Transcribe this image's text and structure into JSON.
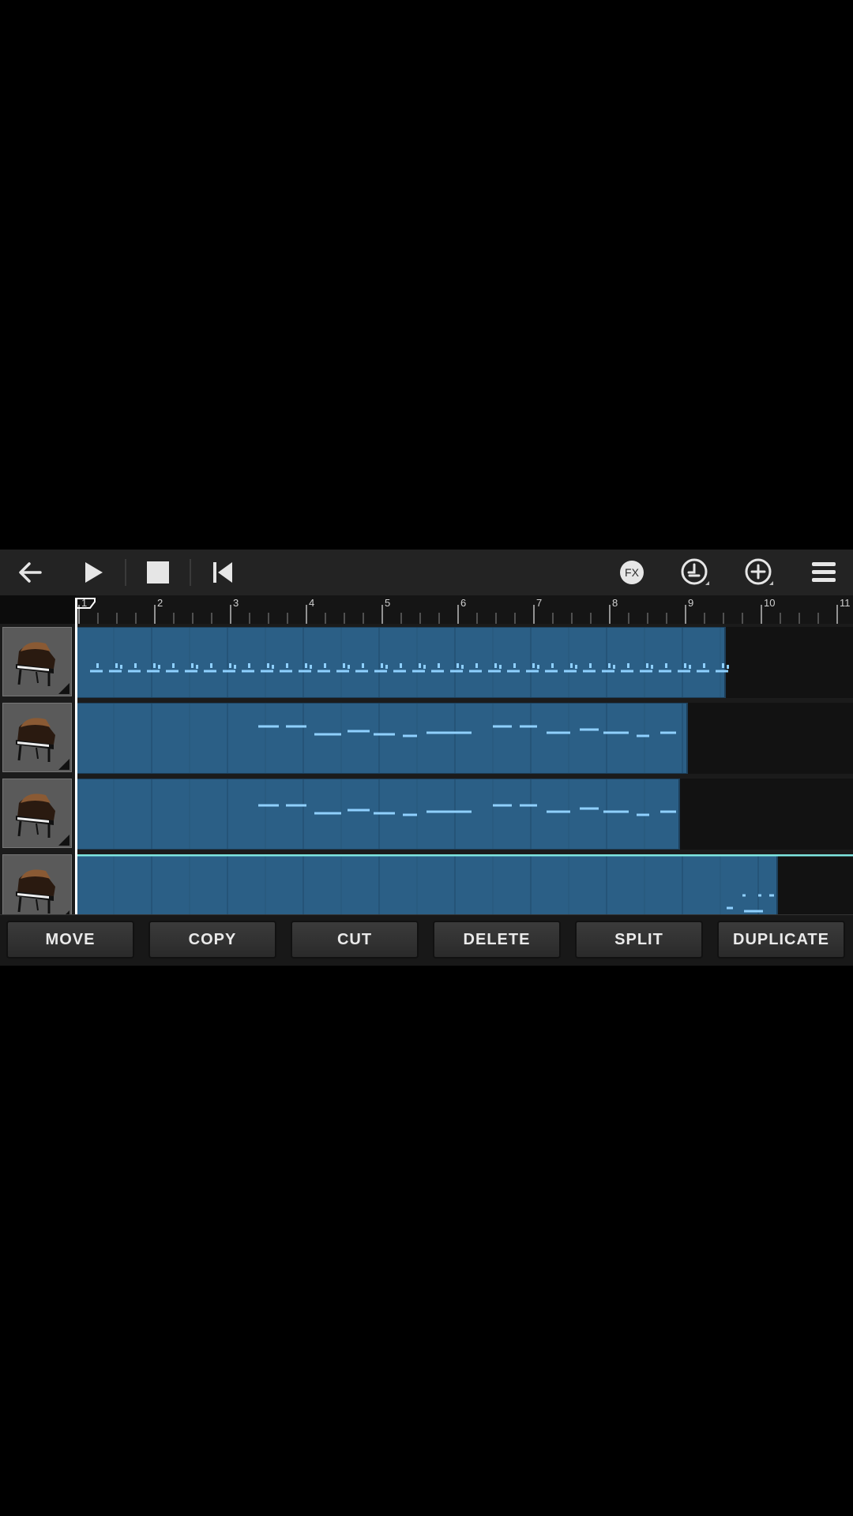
{
  "toolbar": {
    "back_icon": "arrow-left-icon",
    "play_icon": "play-icon",
    "stop_icon": "stop-icon",
    "rewind_icon": "skip-to-start-icon",
    "fx_label": "FX",
    "metronome_icon": "metronome-icon",
    "add_icon": "plus-circle-icon",
    "menu_icon": "hamburger-menu-icon"
  },
  "ruler": {
    "bars": [
      "1",
      "2",
      "3",
      "4",
      "5",
      "6",
      "7",
      "8",
      "9",
      "10",
      "11"
    ]
  },
  "tracks": [
    {
      "instrument_icon": "grand-piano-icon"
    },
    {
      "instrument_icon": "grand-piano-icon"
    },
    {
      "instrument_icon": "grand-piano-icon"
    },
    {
      "instrument_icon": "grand-piano-icon"
    }
  ],
  "actions": {
    "move": "MOVE",
    "copy": "COPY",
    "cut": "CUT",
    "delete": "DELETE",
    "split": "SPLIT",
    "duplicate": "DUPLICATE"
  },
  "colors": {
    "region": "#2b5f86",
    "note": "#8fd0ff",
    "cursor": "#ffffff",
    "selection_line": "#7fe6e0"
  }
}
